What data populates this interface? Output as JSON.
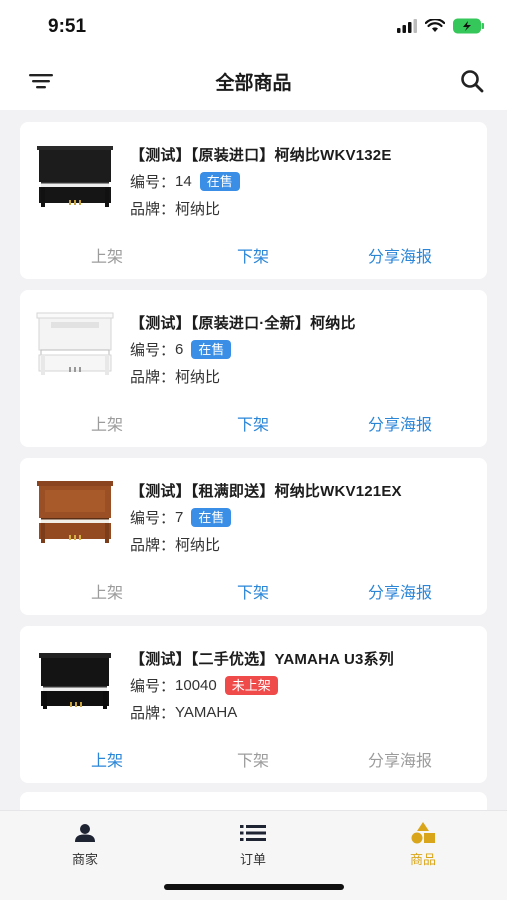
{
  "status_bar": {
    "time": "9:51"
  },
  "header": {
    "title": "全部商品",
    "filter_icon": "filter-icon",
    "search_icon": "search-icon"
  },
  "colors": {
    "accent": "#2b86d8",
    "badge_on_sale": "#3a8ee6",
    "badge_off_sale": "#f04b4b",
    "active_tab": "#d9a61b",
    "disabled_text": "#9c9c9c"
  },
  "products": [
    {
      "title": "【测试】【原装进口】柯纳比WKV132E",
      "code_label": "编号：",
      "code": "14",
      "status": "在售",
      "brand_label": "品牌：",
      "brand": "柯纳比",
      "actions": {
        "list": "上架",
        "delist": "下架",
        "share": "分享海报"
      }
    },
    {
      "title": "【测试】【原装进口·全新】柯纳比",
      "code_label": "编号：",
      "code": "6",
      "status": "在售",
      "brand_label": "品牌：",
      "brand": "柯纳比",
      "actions": {
        "list": "上架",
        "delist": "下架",
        "share": "分享海报"
      }
    },
    {
      "title": "【测试】【租满即送】柯纳比WKV121EX",
      "code_label": "编号：",
      "code": "7",
      "status": "在售",
      "brand_label": "品牌：",
      "brand": "柯纳比",
      "actions": {
        "list": "上架",
        "delist": "下架",
        "share": "分享海报"
      }
    },
    {
      "title": "【测试】【二手优选】YAMAHA U3系列",
      "code_label": "编号：",
      "code": "10040",
      "status": "未上架",
      "brand_label": "品牌：",
      "brand": "YAMAHA",
      "actions": {
        "list": "上架",
        "delist": "下架",
        "share": "分享海报"
      }
    }
  ],
  "tabbar": {
    "items": [
      {
        "label": "商家",
        "icon": "person-icon"
      },
      {
        "label": "订单",
        "icon": "list-icon"
      },
      {
        "label": "商品",
        "icon": "shapes-icon"
      }
    ]
  }
}
